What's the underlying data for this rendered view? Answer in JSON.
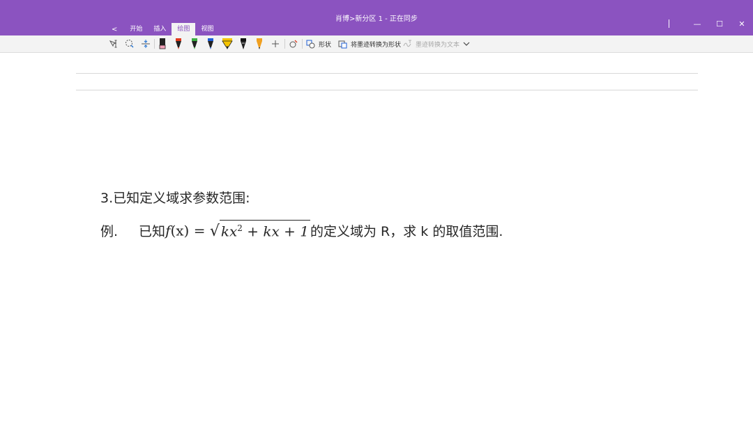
{
  "window": {
    "title": "肖博>新分区 1  - 正在同步",
    "controls": {
      "minimize": "—",
      "maximize": "☐",
      "close": "✕"
    }
  },
  "tabs": [
    {
      "label": "<"
    },
    {
      "label": "开始"
    },
    {
      "label": "插入"
    },
    {
      "label": "绘图",
      "active": true
    },
    {
      "label": "视图"
    }
  ],
  "ribbon": {
    "shapes_label": "形状",
    "ink_to_shape_label": "将墨迹转换为形状",
    "ink_to_text_label": "墨迹转换为文本",
    "pens": [
      {
        "name": "black-marker",
        "color": "#222222",
        "tip": "#f2a0b8"
      },
      {
        "name": "red-pen",
        "color": "#222222",
        "tip": "#e03a1e"
      },
      {
        "name": "green-pen",
        "color": "#222222",
        "tip": "#3cb043"
      },
      {
        "name": "blue-pen",
        "color": "#222222",
        "tip": "#1f5fd6"
      },
      {
        "name": "yellow-highlighter",
        "color": "#f5c400",
        "tip": "#f5c400"
      },
      {
        "name": "black-pen",
        "color": "#222222",
        "tip": "#111111"
      },
      {
        "name": "orange-pen",
        "color": "#f0a020",
        "tip": "#222222"
      }
    ]
  },
  "content": {
    "heading": "3.已知定义域求参数范围:",
    "example_prefix": "例.",
    "example_known": "已知",
    "math_f": "f",
    "math_x_paren": "(x)",
    "math_eq": " = ",
    "math_radicand_a": "kx",
    "math_exp": "2",
    "math_radicand_b": " + kx + 1",
    "example_rest": "的定义域为 R，求 k 的取值范围."
  },
  "colors": {
    "accent": "#8b53c0",
    "ribbon_bg": "#f3f3f3",
    "text": "#262626"
  }
}
